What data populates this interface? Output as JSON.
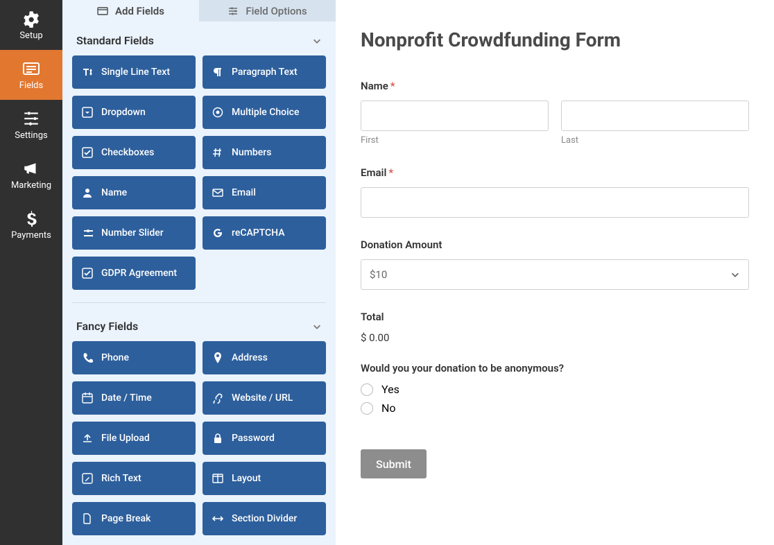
{
  "rail": [
    {
      "name": "setup",
      "label": "Setup"
    },
    {
      "name": "fields",
      "label": "Fields"
    },
    {
      "name": "settings",
      "label": "Settings"
    },
    {
      "name": "marketing",
      "label": "Marketing"
    },
    {
      "name": "payments",
      "label": "Payments"
    }
  ],
  "tabs": {
    "add": "Add Fields",
    "options": "Field Options"
  },
  "sections": {
    "standard": {
      "title": "Standard Fields",
      "items": [
        {
          "icon": "text-height",
          "label": "Single Line Text"
        },
        {
          "icon": "paragraph",
          "label": "Paragraph Text"
        },
        {
          "icon": "caret-square",
          "label": "Dropdown"
        },
        {
          "icon": "dot-circle",
          "label": "Multiple Choice"
        },
        {
          "icon": "check-square",
          "label": "Checkboxes"
        },
        {
          "icon": "hashtag",
          "label": "Numbers"
        },
        {
          "icon": "user",
          "label": "Name"
        },
        {
          "icon": "envelope",
          "label": "Email"
        },
        {
          "icon": "sliders",
          "label": "Number Slider"
        },
        {
          "icon": "google",
          "label": "reCAPTCHA"
        },
        {
          "icon": "check-square",
          "label": "GDPR Agreement"
        }
      ]
    },
    "fancy": {
      "title": "Fancy Fields",
      "items": [
        {
          "icon": "phone",
          "label": "Phone"
        },
        {
          "icon": "map-pin",
          "label": "Address"
        },
        {
          "icon": "calendar",
          "label": "Date / Time"
        },
        {
          "icon": "link",
          "label": "Website / URL"
        },
        {
          "icon": "upload",
          "label": "File Upload"
        },
        {
          "icon": "lock",
          "label": "Password"
        },
        {
          "icon": "edit-square",
          "label": "Rich Text"
        },
        {
          "icon": "columns",
          "label": "Layout"
        },
        {
          "icon": "file",
          "label": "Page Break"
        },
        {
          "icon": "arrows-h",
          "label": "Section Divider"
        }
      ]
    }
  },
  "form": {
    "title": "Nonprofit Crowdfunding Form",
    "name_label": "Name",
    "first": "First",
    "last": "Last",
    "email_label": "Email",
    "donation_label": "Donation Amount",
    "donation_value": "$10",
    "total_label": "Total",
    "total_value": "$ 0.00",
    "anon_label": "Would you your donation to be anonymous?",
    "yes": "Yes",
    "no": "No",
    "submit": "Submit"
  }
}
